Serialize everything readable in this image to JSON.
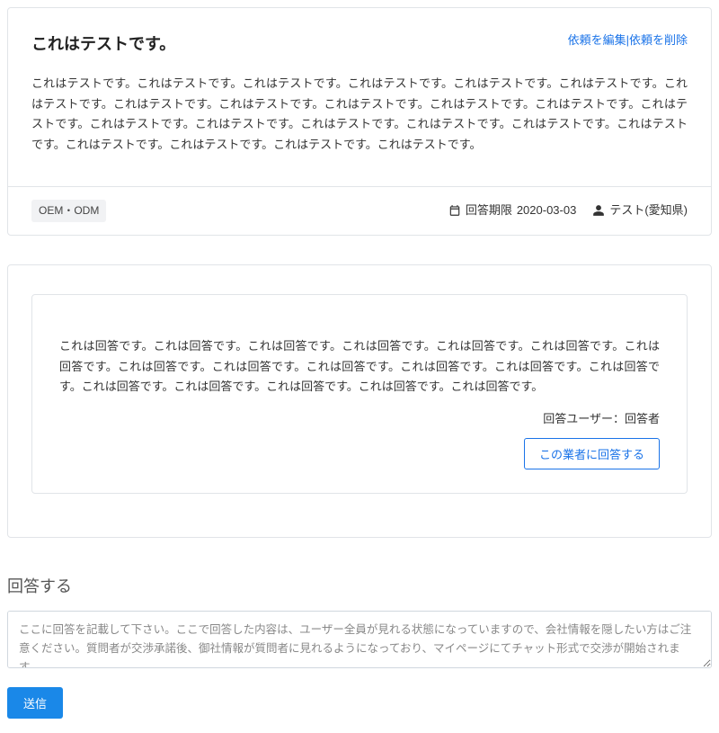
{
  "request": {
    "title": "これはテストです。",
    "edit_link": "依頼を編集",
    "delete_link": "依頼を削除",
    "body": "これはテストです。これはテストです。これはテストです。これはテストです。これはテストです。これはテストです。これはテストです。これはテストです。これはテストです。これはテストです。これはテストです。これはテストです。これはテストです。これはテストです。これはテストです。これはテストです。これはテストです。これはテストです。これはテストです。これはテストです。これはテストです。これはテストです。これはテストです。",
    "tag": "OEM・ODM",
    "deadline_label": "回答期限",
    "deadline_value": "2020-03-03",
    "user_label": "テスト(愛知県)"
  },
  "answer": {
    "body": "これは回答です。これは回答です。これは回答です。これは回答です。これは回答です。これは回答です。これは回答です。これは回答です。これは回答です。これは回答です。これは回答です。これは回答です。これは回答です。これは回答です。これは回答です。これは回答です。これは回答です。これは回答です。",
    "user_label": "回答ユーザー：回答者",
    "reply_button": "この業者に回答する"
  },
  "reply": {
    "heading": "回答する",
    "placeholder": "ここに回答を記載して下さい。ここで回答した内容は、ユーザー全員が見れる状態になっていますので、会社情報を隠したい方はご注意ください。質問者が交渉承諾後、御社情報が質問者に見れるようになっており、マイページにてチャット形式で交渉が開始されます。",
    "submit": "送信"
  }
}
